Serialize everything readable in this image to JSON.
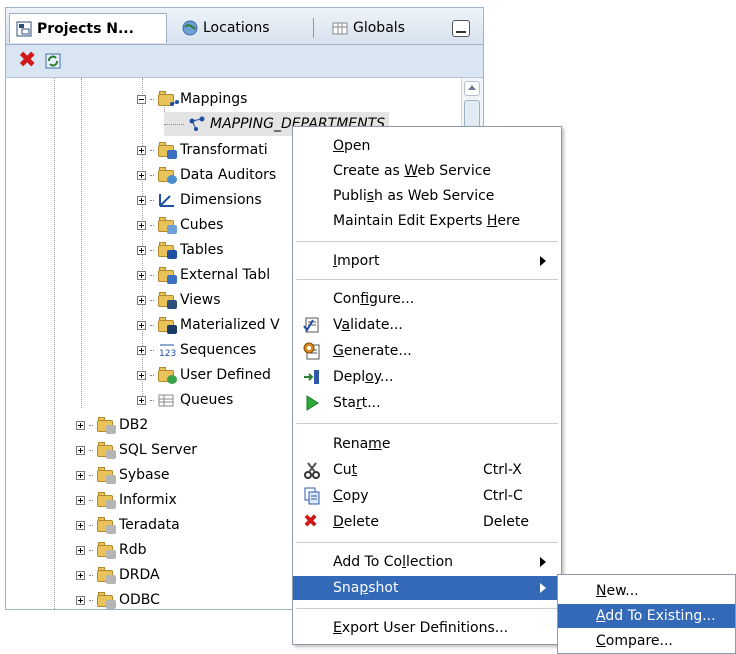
{
  "tabs": [
    {
      "label": "Projects N...",
      "icon": "projects-icon",
      "active": true
    },
    {
      "label": "Locations",
      "icon": "locations-icon",
      "active": false
    },
    {
      "label": "Globals",
      "icon": "globals-icon",
      "active": false
    }
  ],
  "toolbar": {
    "delete_icon": "red-x-delete-icon",
    "refresh_icon": "refresh-icon"
  },
  "tree": {
    "mappings": "Mappings",
    "mapping_departments": "MAPPING_DEPARTMENTS",
    "transformations": "Transformati",
    "data_auditors": "Data Auditors",
    "dimensions": "Dimensions",
    "cubes": "Cubes",
    "tables": "Tables",
    "external_tables": "External Tabl",
    "views": "Views",
    "materialized_views": "Materialized V",
    "sequences": "Sequences",
    "user_defined": "User Defined",
    "queues": "Queues",
    "db2": "DB2",
    "sql_server": "SQL Server",
    "sybase": "Sybase",
    "informix": "Informix",
    "teradata": "Teradata",
    "rdb": "Rdb",
    "drda": "DRDA",
    "odbc": "ODBC"
  },
  "menu": {
    "open": {
      "pre": "",
      "u": "O",
      "post": "pen"
    },
    "create_ws": {
      "pre": "Create as ",
      "u": "W",
      "post": "eb Service"
    },
    "publish_ws": {
      "pre": "Publi",
      "u": "s",
      "post": "h as Web Service"
    },
    "maintain": {
      "pre": "Maintain Edit Experts ",
      "u": "H",
      "post": "ere"
    },
    "import": {
      "pre": "",
      "u": "I",
      "post": "mport"
    },
    "configure": {
      "pre": "Con",
      "u": "f",
      "post": "igure..."
    },
    "validate": {
      "pre": "V",
      "u": "a",
      "post": "lidate..."
    },
    "generate": {
      "pre": "",
      "u": "G",
      "post": "enerate..."
    },
    "deploy": {
      "pre": "Depl",
      "u": "o",
      "post": "y..."
    },
    "start": {
      "pre": "Sta",
      "u": "r",
      "post": "t..."
    },
    "rename": {
      "pre": "Rena",
      "u": "m",
      "post": "e"
    },
    "cut": {
      "pre": "Cu",
      "u": "t",
      "post": "",
      "shortcut": "Ctrl-X"
    },
    "copy": {
      "pre": "",
      "u": "C",
      "post": "opy",
      "shortcut": "Ctrl-C"
    },
    "delete": {
      "pre": "",
      "u": "D",
      "post": "elete",
      "shortcut": "Delete"
    },
    "add_collection": {
      "pre": "Add To Co",
      "u": "l",
      "post": "lection"
    },
    "snapshot": {
      "pre": "Sna",
      "u": "p",
      "post": "shot"
    },
    "export": {
      "pre": "",
      "u": "E",
      "post": "xport User Definitions..."
    }
  },
  "submenu": {
    "new": {
      "pre": "",
      "u": "N",
      "post": "ew..."
    },
    "add_existing": {
      "pre": "",
      "u": "A",
      "post": "dd To Existing..."
    },
    "compare": {
      "pre": "",
      "u": "C",
      "post": "ompare..."
    }
  },
  "colors": {
    "highlight": "#3369b7",
    "toolbar": "#d9e5f3"
  }
}
